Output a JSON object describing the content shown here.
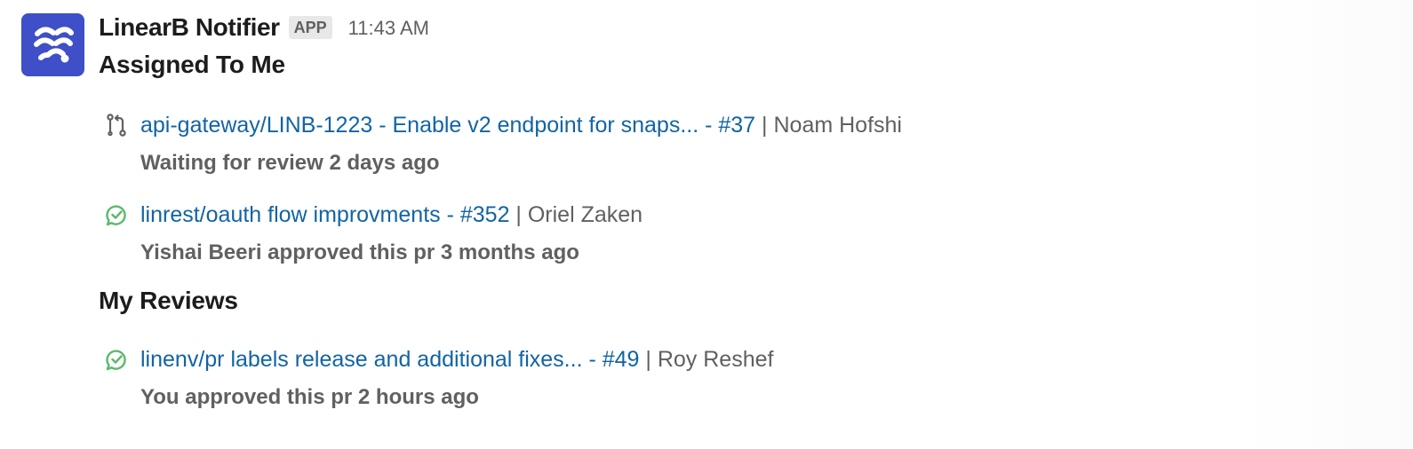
{
  "message": {
    "sender": "LinearB Notifier",
    "badge": "APP",
    "timestamp": "11:43 AM",
    "avatar_icon": "linearb-logo-icon",
    "colors": {
      "avatar_bg": "#3f4fc8",
      "link": "#1264a3",
      "approved_icon": "#5bb96b"
    }
  },
  "sections": {
    "assigned": {
      "title": "Assigned To Me",
      "items": [
        {
          "icon": "pull-request-icon",
          "link": "api-gateway/LINB-1223 - Enable v2 endpoint for snaps... - #37",
          "separator": " | ",
          "author": "Noam Hofshi",
          "status": "Waiting for review 2 days ago"
        },
        {
          "icon": "approved-check-icon",
          "link": "linrest/oauth flow improvments - #352",
          "separator": " | ",
          "author": "Oriel Zaken",
          "status": "Yishai Beeri approved this pr 3 months ago"
        }
      ]
    },
    "reviews": {
      "title": "My Reviews",
      "items": [
        {
          "icon": "approved-check-icon",
          "link": "linenv/pr labels release and additional fixes... - #49",
          "separator": " | ",
          "author": "Roy Reshef",
          "status": "You approved this pr 2 hours ago"
        }
      ]
    }
  }
}
